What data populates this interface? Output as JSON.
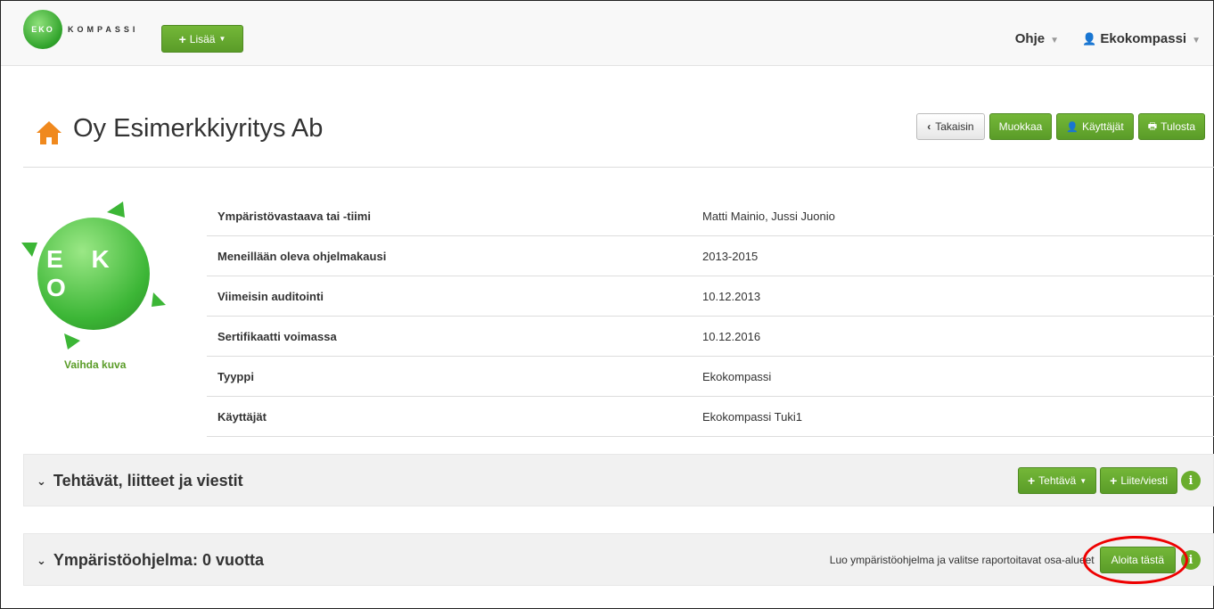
{
  "navbar": {
    "logo_mark": "EKO",
    "logo_text": "KOMPASSI",
    "add_button": "Lisää",
    "help_menu": "Ohje",
    "user_menu": "Ekokompassi"
  },
  "header": {
    "title": "Oy Esimerkkiyritys Ab",
    "back_button": "Takaisin",
    "edit_button": "Muokkaa",
    "users_button": "Käyttäjät",
    "print_button": "Tulosta"
  },
  "profile": {
    "image_text": "E K O",
    "change_image": "Vaihda kuva"
  },
  "info_rows": [
    {
      "label": "Ympäristövastaava tai -tiimi",
      "value": "Matti Mainio, Jussi Juonio"
    },
    {
      "label": "Meneillään oleva ohjelmakausi",
      "value": "2013-2015"
    },
    {
      "label": "Viimeisin auditointi",
      "value": "10.12.2013"
    },
    {
      "label": "Sertifikaatti voimassa",
      "value": "10.12.2016"
    },
    {
      "label": "Tyyppi",
      "value": "Ekokompassi"
    },
    {
      "label": "Käyttäjät",
      "value": "Ekokompassi Tuki1"
    }
  ],
  "panel_tasks": {
    "title": "Tehtävät, liitteet ja viestit",
    "task_button": "Tehtävä",
    "attachment_button": "Liite/viesti",
    "info_icon": "i"
  },
  "panel_program": {
    "title": "Ympäristöohjelma: 0 vuotta",
    "hint": "Luo ympäristöohjelma ja valitse raportoitavat osa-alueet",
    "start_button": "Aloita tästä",
    "info_icon": "i"
  },
  "colors": {
    "accent": "#5a9c28",
    "highlight_ring": "#e00000",
    "home_icon": "#f0891e"
  }
}
